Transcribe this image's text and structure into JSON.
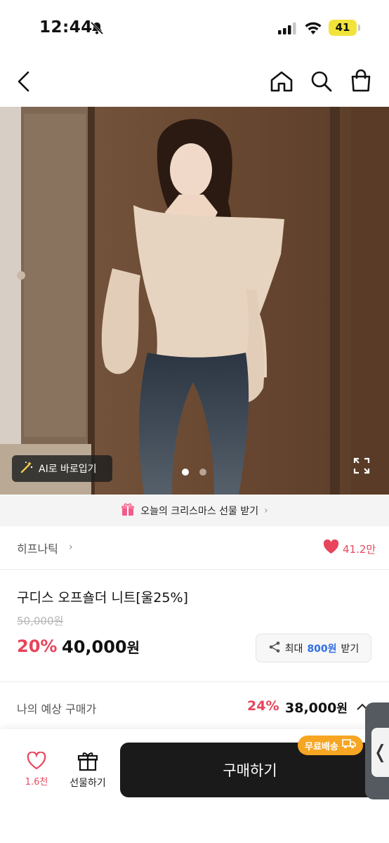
{
  "status_bar": {
    "time": "12:44",
    "battery": "41"
  },
  "nav": {
    "back_icon": "chevron-left-icon",
    "home_icon": "home-icon",
    "search_icon": "search-icon",
    "bag_icon": "shopping-bag-icon"
  },
  "gallery": {
    "ai_button_label": "AI로 바로입기",
    "page_count": 2,
    "active_index": 0
  },
  "banner": {
    "text": "오늘의 크리스마스 선물 받기",
    "chevron": "›"
  },
  "brand": {
    "name": "히프나틱",
    "chevron": "›",
    "likes": "41.2만"
  },
  "product": {
    "name": "구디스 오프숄더 니트[울25%]",
    "original_price": "50,000원",
    "discount": "20%",
    "price_number": "40,000",
    "price_unit": "원",
    "coupon_prefix": "최대",
    "coupon_amount": "800원",
    "coupon_suffix": "받기"
  },
  "expected": {
    "label": "나의 예상 구매가",
    "discount": "24%",
    "price_number": "38,000",
    "price_unit": "원"
  },
  "bottom_bar": {
    "like_count": "1.6천",
    "gift_label": "선물하기",
    "buy_label": "구매하기",
    "shipping_badge": "무료배송",
    "side_tab": "❬"
  },
  "colors": {
    "accent_pink": "#e8445a",
    "accent_blue": "#2f6fe4",
    "badge_orange": "#f6a623",
    "buy_black": "#1a1a1a"
  }
}
